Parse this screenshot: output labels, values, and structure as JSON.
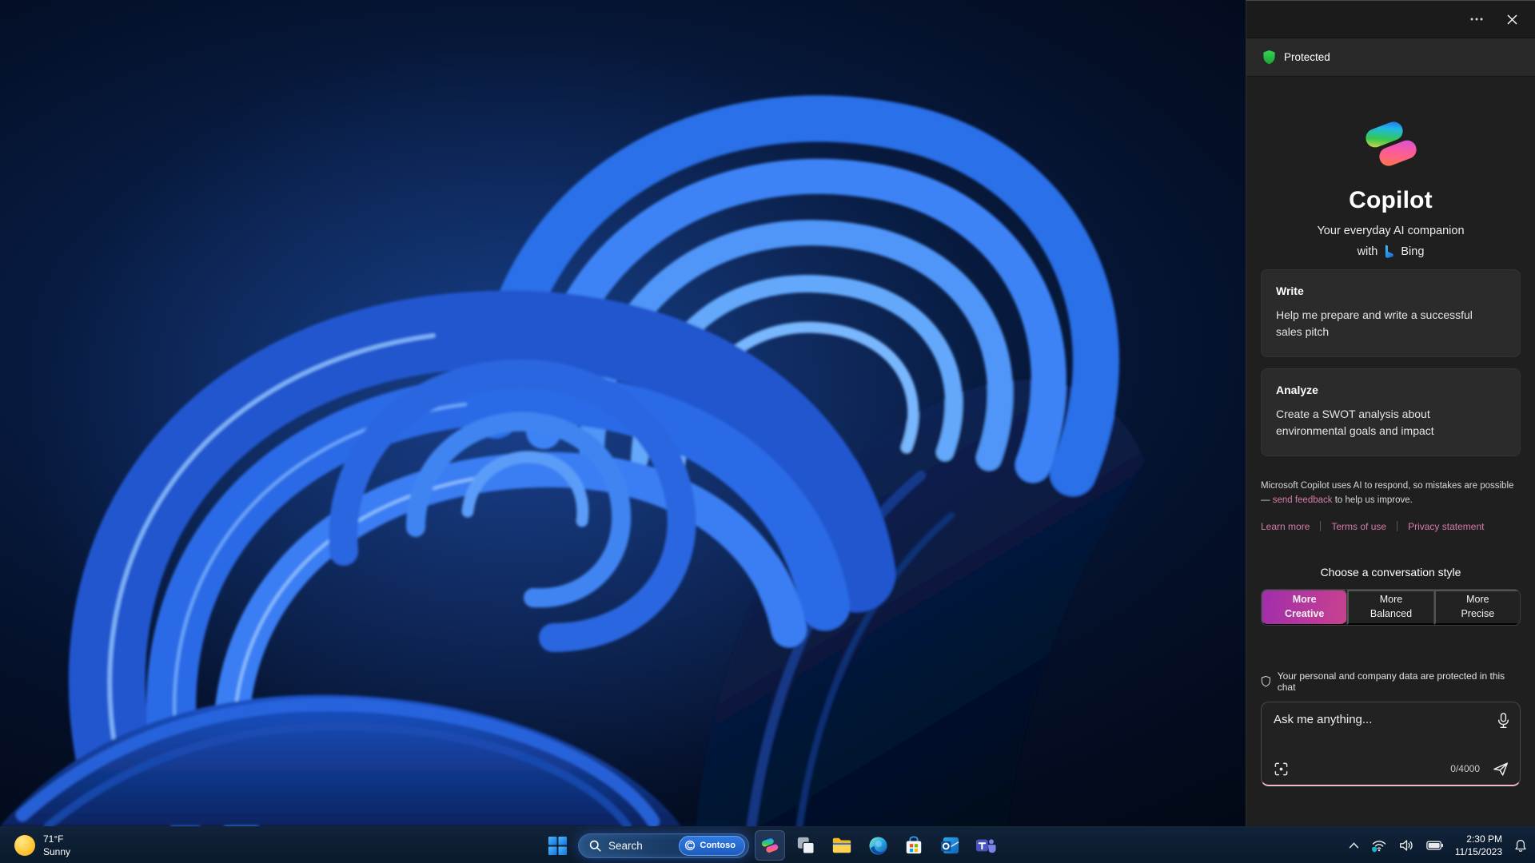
{
  "copilot_panel": {
    "protected_label": "Protected",
    "hero": {
      "title": "Copilot",
      "subtitle": "Your everyday AI companion",
      "with_text": "with",
      "bing_label": "Bing"
    },
    "cards": [
      {
        "title": "Write",
        "body": "Help me prepare and write a successful sales pitch"
      },
      {
        "title": "Analyze",
        "body": "Create a SWOT analysis about environmental goals and impact"
      }
    ],
    "disclaimer": {
      "line1": "Microsoft Copilot uses AI to respond, so mistakes are possible",
      "line2_pre": "— ",
      "line2_link": "send feedback",
      "line2_post": " to help us improve."
    },
    "footer_links": [
      {
        "label": "Learn more"
      },
      {
        "label": "Terms of use"
      },
      {
        "label": "Privacy statement"
      }
    ],
    "style_chooser": {
      "title": "Choose a conversation style",
      "selected_index": 0,
      "options": [
        {
          "top": "More",
          "bottom": "Creative"
        },
        {
          "top": "More",
          "bottom": "Balanced"
        },
        {
          "top": "More",
          "bottom": "Precise"
        }
      ]
    },
    "privacy_note": "Your personal and company data are protected in this chat",
    "composer": {
      "placeholder": "Ask me anything...",
      "char_counter": "0/4000"
    }
  },
  "taskbar": {
    "weather": {
      "temperature": "71°F",
      "condition": "Sunny"
    },
    "search": {
      "label": "Search",
      "badge": "Contoso"
    },
    "apps": [
      "start",
      "search",
      "copilot",
      "task-view",
      "file-explorer",
      "edge",
      "store",
      "outlook",
      "teams"
    ],
    "tray": {
      "time": "2:30 PM",
      "date": "11/15/2023"
    }
  },
  "colors": {
    "link_pink": "#d57daa",
    "creative_gradient_start": "#a12dab",
    "creative_gradient_end": "#c8428f",
    "protected_green": "#2fc247",
    "composer_underline": "#f0b6d2",
    "panel_bg": "#1f1f1f",
    "card_bg": "#2b2b2b",
    "taskbar_bg": "#0d1d31"
  }
}
